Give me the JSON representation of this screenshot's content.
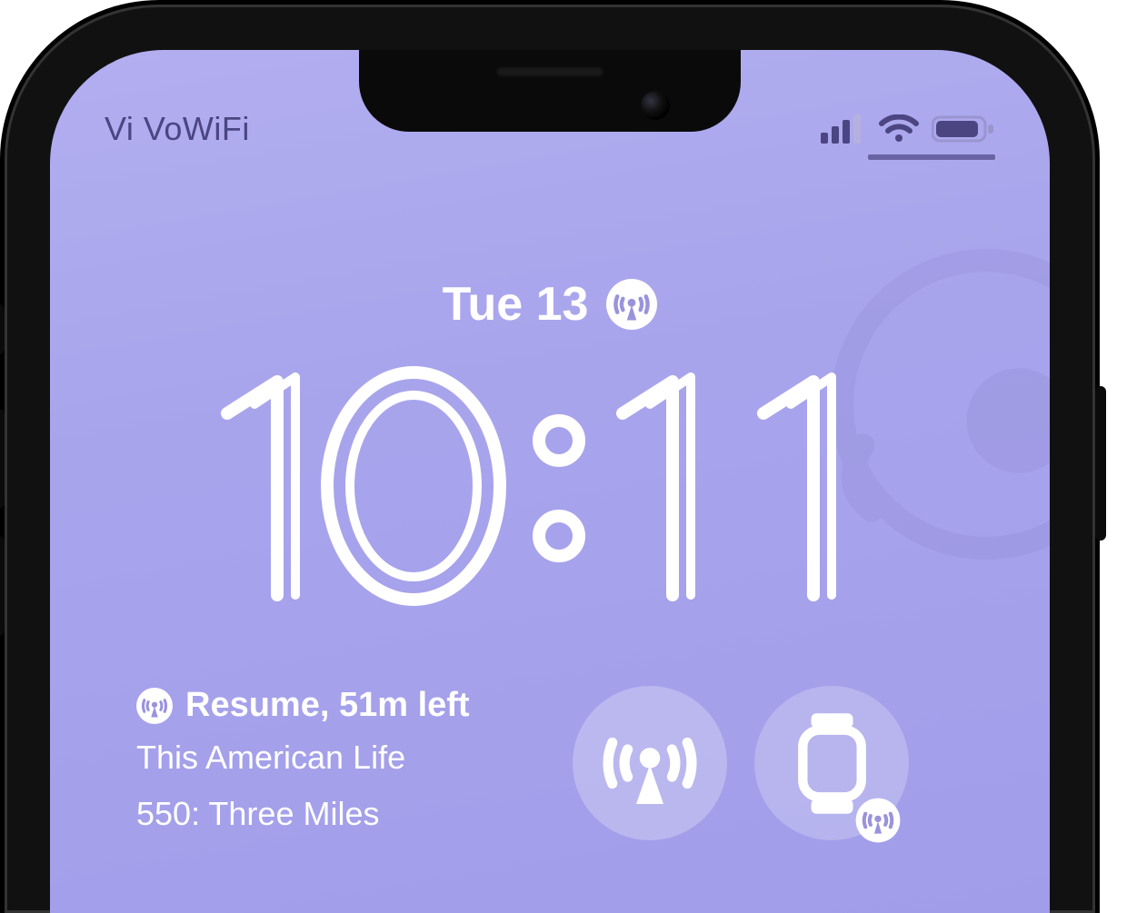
{
  "status": {
    "carrier": "Vi VoWiFi",
    "signal_bars": 3,
    "wifi_bars": 3,
    "battery_pct": 85
  },
  "lockscreen": {
    "date": "Tue 13",
    "time": "10:11",
    "date_icon": "podcast-tower-icon"
  },
  "now_playing": {
    "status_line": "Resume, 51m left",
    "show": "This American Life",
    "episode": "550: Three Miles",
    "icon": "podcast-tower-icon"
  },
  "widgets": {
    "slot1_icon": "podcast-tower-icon",
    "slot2_icon": "watch-icon",
    "slot2_badge_icon": "podcast-tower-icon"
  },
  "colors": {
    "bg_top": "#b2aef0",
    "bg_bottom": "#9f9be8",
    "status_tint": "#4b4582",
    "white": "#ffffff"
  }
}
